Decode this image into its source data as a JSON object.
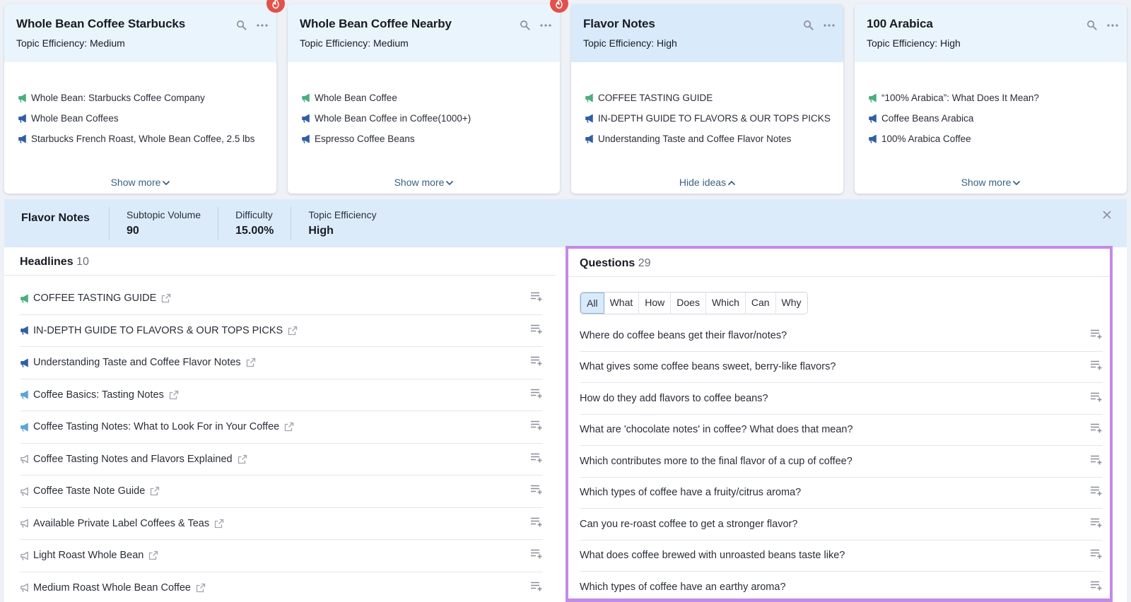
{
  "colors": {
    "accent_purple": "#c38ae6",
    "mega_green": "#4bae7f",
    "mega_blue": "#2f5fa8",
    "mega_lightblue": "#5ba6d6",
    "mega_gray": "#9a9ca6",
    "fire_red": "#e2514b"
  },
  "cards": [
    {
      "title": "Whole Bean Coffee Starbucks",
      "efficiency": "Topic Efficiency: Medium",
      "hot": true,
      "active": false,
      "ideas": [
        {
          "text": "Whole Bean: Starbucks Coffee Company",
          "icon": "megaphone-green"
        },
        {
          "text": "Whole Bean Coffees",
          "icon": "megaphone-blue"
        },
        {
          "text": "Starbucks French Roast, Whole Bean Coffee, 2.5 lbs",
          "icon": "megaphone-blue"
        }
      ],
      "toggle": "Show more",
      "toggle_icon": "chevron-down-icon"
    },
    {
      "title": "Whole Bean Coffee Nearby",
      "efficiency": "Topic Efficiency: Medium",
      "hot": true,
      "active": false,
      "ideas": [
        {
          "text": "Whole Bean Coffee",
          "icon": "megaphone-green"
        },
        {
          "text": "Whole Bean Coffee in Coffee(1000+)",
          "icon": "megaphone-blue"
        },
        {
          "text": "Espresso Coffee Beans",
          "icon": "megaphone-blue"
        }
      ],
      "toggle": "Show more",
      "toggle_icon": "chevron-down-icon"
    },
    {
      "title": "Flavor Notes",
      "efficiency": "Topic Efficiency: High",
      "hot": false,
      "active": true,
      "ideas": [
        {
          "text": "COFFEE TASTING GUIDE",
          "icon": "megaphone-green"
        },
        {
          "text": "IN-DEPTH GUIDE TO FLAVORS & OUR TOPS PICKS",
          "icon": "megaphone-blue"
        },
        {
          "text": "Understanding Taste and Coffee Flavor Notes",
          "icon": "megaphone-blue"
        }
      ],
      "toggle": "Hide ideas",
      "toggle_icon": "chevron-up-icon"
    },
    {
      "title": "100 Arabica",
      "efficiency": "Topic Efficiency: High",
      "hot": false,
      "active": false,
      "ideas": [
        {
          "text": "“100% Arabica”: What Does It Mean?",
          "icon": "megaphone-green"
        },
        {
          "text": "Coffee Beans Arabica",
          "icon": "megaphone-blue"
        },
        {
          "text": "100% Arabica Coffee",
          "icon": "megaphone-blue"
        }
      ],
      "toggle": "Show more",
      "toggle_icon": "chevron-down-icon"
    }
  ],
  "summary": {
    "title": "Flavor Notes",
    "metrics": [
      {
        "label": "Subtopic Volume",
        "value": "90"
      },
      {
        "label": "Difficulty",
        "value": "15.00%"
      },
      {
        "label": "Topic Efficiency",
        "value": "High"
      }
    ]
  },
  "headlines": {
    "title": "Headlines",
    "count": "10",
    "items": [
      {
        "text": "COFFEE TASTING GUIDE",
        "icon": "megaphone-green"
      },
      {
        "text": "IN-DEPTH GUIDE TO FLAVORS & OUR TOPS PICKS",
        "icon": "megaphone-blue"
      },
      {
        "text": "Understanding Taste and Coffee Flavor Notes",
        "icon": "megaphone-blue"
      },
      {
        "text": "Coffee Basics: Tasting Notes",
        "icon": "megaphone-lightblue"
      },
      {
        "text": "Coffee Tasting Notes: What to Look For in Your Coffee",
        "icon": "megaphone-lightblue"
      },
      {
        "text": "Coffee Tasting Notes and Flavors Explained",
        "icon": "megaphone-gray"
      },
      {
        "text": "Coffee Taste Note Guide",
        "icon": "megaphone-gray"
      },
      {
        "text": "Available Private Label Coffees & Teas",
        "icon": "megaphone-gray"
      },
      {
        "text": "Light Roast Whole Bean",
        "icon": "megaphone-gray"
      },
      {
        "text": "Medium Roast Whole Bean Coffee",
        "icon": "megaphone-gray"
      }
    ]
  },
  "questions": {
    "title": "Questions",
    "count": "29",
    "filters": [
      "All",
      "What",
      "How",
      "Does",
      "Which",
      "Can",
      "Why"
    ],
    "active_filter": "All",
    "items": [
      "Where do coffee beans get their flavor/notes?",
      "What gives some coffee beans sweet, berry-like flavors?",
      "How do they add flavors to coffee beans?",
      "What are 'chocolate notes' in coffee? What does that mean?",
      "Which contributes more to the final flavor of a cup of coffee?",
      "Which types of coffee have a fruity/citrus aroma?",
      "Can you re-roast coffee to get a stronger flavor?",
      "What does coffee brewed with unroasted beans taste like?",
      "Which types of coffee have an earthy aroma?"
    ]
  }
}
